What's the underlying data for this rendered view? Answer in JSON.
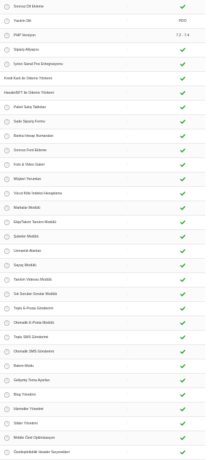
{
  "columns": {
    "separator": ":"
  },
  "icons": {
    "info": "info-circle-icon",
    "check": "check-icon"
  },
  "colors": {
    "check": "#2aa52f"
  },
  "rows": [
    {
      "label": "Sınırsız Dil Ekleme",
      "info": true,
      "value_type": "check",
      "value": ""
    },
    {
      "label": "Yazılım Dili",
      "info": true,
      "value_type": "text",
      "value": "PDO"
    },
    {
      "label": "PHP Versiyon",
      "info": true,
      "value_type": "text",
      "value": "7.2 - 7.4"
    },
    {
      "label": "Sipariş Altyapısı",
      "info": true,
      "value_type": "check",
      "value": ""
    },
    {
      "label": "İyzico Sanal Pos Entegrasyonu",
      "info": true,
      "value_type": "check",
      "value": ""
    },
    {
      "label": "Kredi Kartı ile Ödeme Yöntemi",
      "info": false,
      "value_type": "check",
      "value": ""
    },
    {
      "label": "Havale/EFT ile Ödeme Yöntemi",
      "info": false,
      "value_type": "check",
      "value": ""
    },
    {
      "label": "Paket Satış Tabloları",
      "info": true,
      "value_type": "check",
      "value": ""
    },
    {
      "label": "Sade Sipariş Formu",
      "info": true,
      "value_type": "check",
      "value": ""
    },
    {
      "label": "Banka Hesap Numaraları",
      "info": true,
      "value_type": "check",
      "value": ""
    },
    {
      "label": "Sınırsız Font Ekleme",
      "info": true,
      "value_type": "check",
      "value": ""
    },
    {
      "label": "Foto & Video Galeri",
      "info": true,
      "value_type": "check",
      "value": ""
    },
    {
      "label": "Müşteri Yorumları",
      "info": true,
      "value_type": "check",
      "value": ""
    },
    {
      "label": "Vücut Kitle İndeksi Hesaplama",
      "info": true,
      "value_type": "check",
      "value": ""
    },
    {
      "label": "Markalar Modülü",
      "info": true,
      "value_type": "check",
      "value": ""
    },
    {
      "label": "Ekip/Takım Tanıtım Modülü",
      "info": true,
      "value_type": "check",
      "value": ""
    },
    {
      "label": "Şubeler Modülü",
      "info": true,
      "value_type": "check",
      "value": ""
    },
    {
      "label": "Uzmanlık Alanları",
      "info": true,
      "value_type": "check",
      "value": ""
    },
    {
      "label": "Sayaç Modülü",
      "info": true,
      "value_type": "check",
      "value": ""
    },
    {
      "label": "Tanıtım Videosu Modülü",
      "info": true,
      "value_type": "check",
      "value": ""
    },
    {
      "label": "Sık Sorulan Sorular Modülü",
      "info": true,
      "value_type": "check",
      "value": ""
    },
    {
      "label": "Toplu E-Posta Gönderimi",
      "info": true,
      "value_type": "check",
      "value": ""
    },
    {
      "label": "Otomatik E-Posta Modülü",
      "info": true,
      "value_type": "check",
      "value": ""
    },
    {
      "label": "Toplu SMS Gönderimi",
      "info": true,
      "value_type": "check",
      "value": ""
    },
    {
      "label": "Otomatik SMS Gönderimi",
      "info": true,
      "value_type": "check",
      "value": ""
    },
    {
      "label": "Bakım Modu",
      "info": true,
      "value_type": "check",
      "value": ""
    },
    {
      "label": "Gelişmiş Tema Ayarları",
      "info": true,
      "value_type": "check",
      "value": ""
    },
    {
      "label": "Blog Yönetimi",
      "info": true,
      "value_type": "check",
      "value": ""
    },
    {
      "label": "Hizmetler Yönetimi",
      "info": true,
      "value_type": "check",
      "value": ""
    },
    {
      "label": "Slider Yönetimi",
      "info": true,
      "value_type": "check",
      "value": ""
    },
    {
      "label": "Mobile Özel Optimizasyon",
      "info": true,
      "value_type": "check",
      "value": ""
    },
    {
      "label": "Özelleştirilebilir Header Seçenekleri",
      "info": true,
      "value_type": "check",
      "value": ""
    }
  ]
}
